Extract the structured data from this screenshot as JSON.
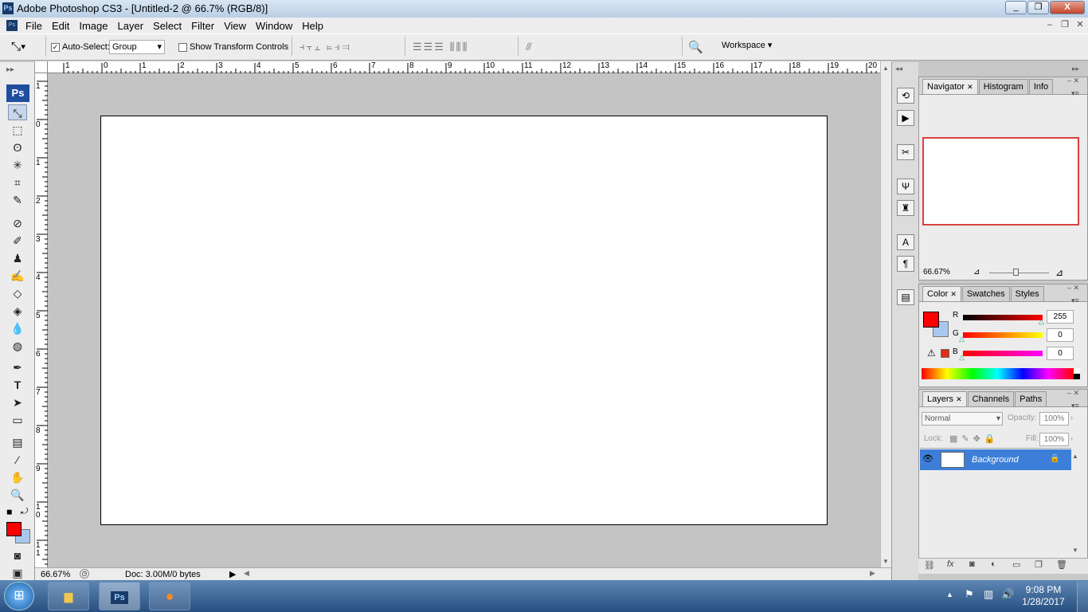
{
  "window": {
    "title": "Adobe Photoshop CS3 - [Untitled-2 @ 66.7% (RGB/8)]",
    "minimize": "_",
    "restore": "❐",
    "close": "X"
  },
  "menu": {
    "items": [
      "File",
      "Edit",
      "Image",
      "Layer",
      "Select",
      "Filter",
      "View",
      "Window",
      "Help"
    ]
  },
  "options": {
    "auto_select_label": "Auto-Select:",
    "auto_select_checked": true,
    "auto_select_value": "Group",
    "show_transform_label": "Show Transform Controls",
    "show_transform_checked": false,
    "workspace_label": "Workspace"
  },
  "ruler": {
    "h_ticks": [
      "1",
      "0",
      "1",
      "2",
      "3",
      "4",
      "5",
      "6",
      "7",
      "8",
      "9",
      "10",
      "11",
      "12",
      "13",
      "14",
      "15",
      "16",
      "17",
      "18",
      "19",
      "20"
    ],
    "v_ticks": [
      "1",
      "0",
      "1",
      "2",
      "3",
      "4",
      "5",
      "6",
      "7",
      "8",
      "9",
      "1\n0",
      "1\n1"
    ]
  },
  "status": {
    "zoom": "66.67%",
    "doc": "Doc: 3.00M/0 bytes"
  },
  "navigator": {
    "tabs": [
      "Navigator",
      "Histogram",
      "Info"
    ],
    "zoom": "66.67%"
  },
  "color": {
    "tabs": [
      "Color",
      "Swatches",
      "Styles"
    ],
    "fg_color": "#ff0000",
    "bg_color": "#a8c8f0",
    "channels": [
      {
        "label": "R",
        "value": "255"
      },
      {
        "label": "G",
        "value": "0"
      },
      {
        "label": "B",
        "value": "0"
      }
    ]
  },
  "layers": {
    "tabs": [
      "Layers",
      "Channels",
      "Paths"
    ],
    "blend_mode": "Normal",
    "opacity_label": "Opacity:",
    "opacity": "100%",
    "lock_label": "Lock:",
    "fill_label": "Fill:",
    "fill": "100%",
    "items": [
      {
        "name": "Background"
      }
    ]
  },
  "taskbar": {
    "time": "9:08 PM",
    "date": "1/28/2017",
    "apps": [
      "explorer-icon",
      "photoshop-icon",
      "firefox-icon"
    ],
    "ps_label": "Ps"
  }
}
